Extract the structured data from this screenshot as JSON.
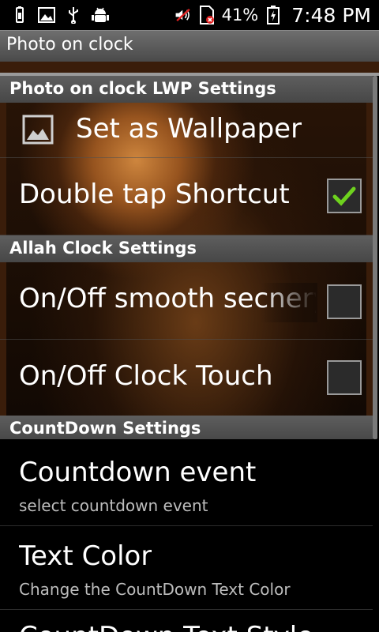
{
  "status_bar": {
    "battery_percent": "41%",
    "time": "7:48 PM",
    "icons": [
      "usb-storage-icon",
      "image-icon",
      "usb-icon",
      "android-debug-icon",
      "volume-muted-icon",
      "no-sim-icon",
      "battery-icon"
    ]
  },
  "app_title": "Photo on clock",
  "sections": {
    "lwp": {
      "header": "Photo on clock LWP Settings"
    },
    "allah": {
      "header": "Allah Clock Settings"
    },
    "countdown": {
      "header": "CountDown Settings"
    }
  },
  "items": {
    "set_wallpaper": {
      "label": "Set as Wallpaper",
      "icon": "picture-icon"
    },
    "double_tap": {
      "label": "Double tap Shortcut",
      "checked": true
    },
    "smooth_scene": {
      "label": "On/Off smooth secnery",
      "checked": false
    },
    "clock_touch": {
      "label": "On/Off Clock Touch",
      "checked": false
    },
    "countdown_event": {
      "label": "Countdown event",
      "summary": "select countdown event"
    },
    "text_color": {
      "label": "Text Color",
      "summary": "Change the CountDown Text Color"
    },
    "text_style": {
      "label": "CountDown Text Style"
    }
  },
  "colors": {
    "checkmark": "#6ed21e",
    "section_header": "#555555",
    "title_bar": "#5a5a5a"
  }
}
